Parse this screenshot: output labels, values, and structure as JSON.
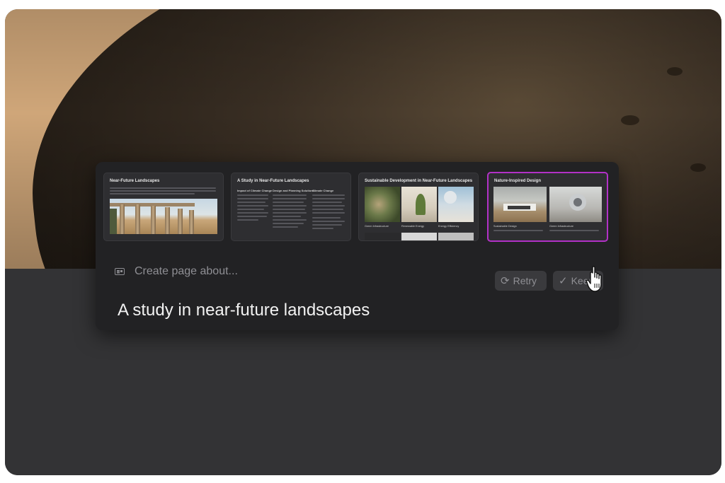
{
  "thumbnails": [
    {
      "title": "Near-Future Landscapes"
    },
    {
      "title": "A Study in Near-Future Landscapes",
      "columns": [
        "Impact of Climate Change",
        "Design and Planning Solutions",
        "Climate Change"
      ]
    },
    {
      "title": "Sustainable Development in Near-Future Landscapes",
      "captions": [
        "Green Infrastructure",
        "Renewable Energy",
        "Energy Efficiency"
      ]
    },
    {
      "title": "Nature-Inspired Design",
      "captions": [
        "Sustainable Design",
        "Green Infrastructure"
      ],
      "selected": true
    }
  ],
  "prompt": {
    "icon": "card-icon",
    "placeholder": "Create page about...",
    "text": "A study in near-future landscapes"
  },
  "buttons": {
    "retry": {
      "label": "Retry",
      "icon": "refresh-icon"
    },
    "keep": {
      "label": "Keep",
      "icon": "check-icon"
    }
  },
  "colors": {
    "selected_border": "#b231c7",
    "panel": "#222224"
  }
}
